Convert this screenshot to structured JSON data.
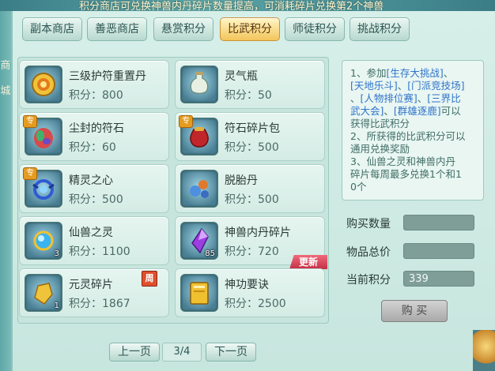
{
  "marquee": "积分商店可兑换神兽内丹碎片数量提高，可消耗碎片兑换第2个神兽",
  "side_text": [
    "商",
    "城"
  ],
  "tabs": [
    {
      "label": "副本商店",
      "active": false
    },
    {
      "label": "善恶商店",
      "active": false
    },
    {
      "label": "悬赏积分",
      "active": false
    },
    {
      "label": "比武积分",
      "active": true
    },
    {
      "label": "师徒积分",
      "active": false
    },
    {
      "label": "挑战积分",
      "active": false
    }
  ],
  "items": [
    {
      "name": "三级护符重置丹",
      "price": "积分：800",
      "icon": "gold-medal-icon"
    },
    {
      "name": "灵气瓶",
      "price": "积分：50",
      "icon": "vase-icon"
    },
    {
      "name": "尘封的符石",
      "price": "积分：60",
      "icon": "gem-stone-icon",
      "tag": "专"
    },
    {
      "name": "符石碎片包",
      "price": "积分：500",
      "icon": "red-bag-icon",
      "tag": "专"
    },
    {
      "name": "精灵之心",
      "price": "积分：500",
      "icon": "spirit-heart-icon",
      "tag": "专"
    },
    {
      "name": "脱胎丹",
      "price": "积分：500",
      "icon": "pills-icon"
    },
    {
      "name": "仙兽之灵",
      "price": "积分：1100",
      "icon": "blue-orb-icon",
      "count": "3"
    },
    {
      "name": "神兽内丹碎片",
      "price": "积分：720",
      "icon": "purple-crystal-icon",
      "count": "85",
      "badge": "更新"
    },
    {
      "name": "元灵碎片",
      "price": "积分：1867",
      "icon": "gold-shard-icon",
      "count": "1",
      "badge": "周"
    },
    {
      "name": "神功要诀",
      "price": "积分：2500",
      "icon": "gold-book-icon"
    }
  ],
  "info": {
    "l1a": "1、参加",
    "l1b": "[生存大挑战]",
    "l1c": "、",
    "l2a": "[天地乐斗]",
    "l2b": "、",
    "l2c": "[门派竞技场]",
    "l3a": "、",
    "l3b": "[人物排位赛]",
    "l3c": "、",
    "l3d": "[三界比",
    "l4a": "武大会]",
    "l4b": "、",
    "l4c": "[群雄逐鹿]",
    "l4d": "可以",
    "l5": "获得比武积分",
    "l6": "2、所获得的比武积分可以",
    "l7": "通用兑换奖励",
    "l8": "3、仙兽之灵和神兽内丹",
    "l9": "碎片每周最多兑换1个和1",
    "l10": "0个"
  },
  "purchase": {
    "qty_label": "购买数量",
    "qty_value": "",
    "total_label": "物品总价",
    "total_value": "",
    "points_label": "当前积分",
    "points_value": "339",
    "buy_label": "购 买"
  },
  "pager": {
    "prev": "上一页",
    "page": "3/4",
    "next": "下一页"
  },
  "colors": {
    "active_tab": "#f3c55a",
    "new_badge": "#d2384d",
    "link_text": "#2f74c9"
  }
}
